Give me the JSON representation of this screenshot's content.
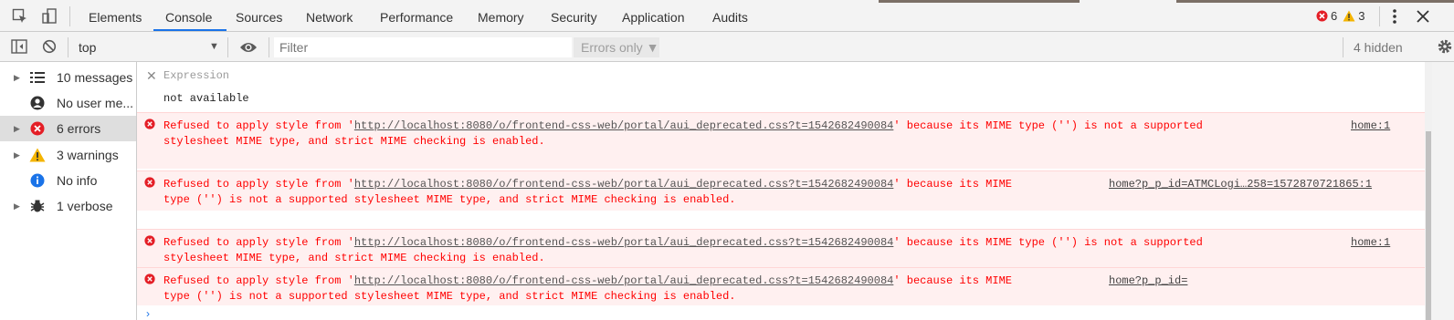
{
  "tabs": [
    "Elements",
    "Console",
    "Sources",
    "Network",
    "Performance",
    "Memory",
    "Security",
    "Application",
    "Audits"
  ],
  "active_tab": "Console",
  "counts": {
    "errors": "6",
    "warnings": "3"
  },
  "toolbar": {
    "context": "top",
    "filter_placeholder": "Filter",
    "levels": "Errors only ▼",
    "hidden": "4 hidden"
  },
  "sidebar": [
    {
      "label": "10 messages",
      "icon": "list-icon",
      "expandable": true,
      "selected": false
    },
    {
      "label": "No user me...",
      "icon": "user-icon",
      "expandable": false,
      "selected": false
    },
    {
      "label": "6 errors",
      "icon": "error-icon",
      "expandable": true,
      "selected": true
    },
    {
      "label": "3 warnings",
      "icon": "warning-icon",
      "expandable": true,
      "selected": false
    },
    {
      "label": "No info",
      "icon": "info-icon",
      "expandable": false,
      "selected": false
    },
    {
      "label": "1 verbose",
      "icon": "bug-icon",
      "expandable": true,
      "selected": false
    }
  ],
  "expression": {
    "placeholder": "Expression",
    "value": "not available"
  },
  "messages": [
    {
      "line1_pre": "Refused to apply style from '",
      "url": "http://localhost:8080/o/frontend-css-web/portal/aui_deprecated.css?t=1542682490084",
      "line1_post": "' because its MIME type ('') is not a supported",
      "line2": "stylesheet MIME type, and strict MIME checking is enabled.",
      "source": "home:1"
    },
    {
      "line1_pre": "Refused to apply style from '",
      "url": "http://localhost:8080/o/frontend-css-web/portal/aui_deprecated.css?t=1542682490084",
      "line1_post": "' because its MIME",
      "line2": "type ('') is not a supported stylesheet MIME type, and strict MIME checking is enabled.",
      "source": "home?p_p_id=ATMCLogi…258=1572870721865:1"
    },
    {
      "line1_pre": "Refused to apply style from '",
      "url": "http://localhost:8080/o/frontend-css-web/portal/aui_deprecated.css?t=1542682490084",
      "line1_post": "' because its MIME type ('') is not a supported",
      "line2": "stylesheet MIME type, and strict MIME checking is enabled.",
      "source": "home:1"
    },
    {
      "line1_pre": "Refused to apply style from '",
      "url": "http://localhost:8080/o/frontend-css-web/portal/aui_deprecated.css?t=1542682490084",
      "line1_post": "' because its MIME",
      "line2": "type ('') is not a supported stylesheet MIME type, and strict MIME checking is enabled.",
      "source": "home?p_p_id="
    }
  ],
  "colors": {
    "error_text": "#ff0000",
    "error_bg": "#fff0f0",
    "accent": "#1a73e8",
    "warning": "#f4b400"
  }
}
